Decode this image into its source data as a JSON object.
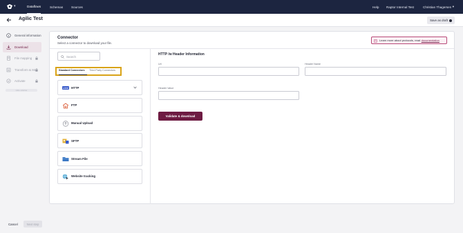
{
  "topbar": {
    "nav": [
      {
        "label": "Dataflows",
        "active": true
      },
      {
        "label": "Schemas",
        "active": false
      },
      {
        "label": "Sources",
        "active": false
      }
    ],
    "help": "Help",
    "workspace": "Raptor Internal Test",
    "user": "Christian Thagersen"
  },
  "header": {
    "title": "Agilic Test",
    "save_draft": "Save as draft"
  },
  "sidebar": {
    "items": [
      {
        "label": "General information",
        "icon": "info-icon",
        "active": false,
        "locked": false
      },
      {
        "label": "Download",
        "icon": "download-icon",
        "active": true,
        "locked": false
      },
      {
        "label": "File mapping",
        "icon": "file-icon",
        "active": false,
        "locked": true
      },
      {
        "label": "Transform & Map",
        "icon": "transform-icon",
        "active": false,
        "locked": true
      },
      {
        "label": "Activate",
        "icon": "activate-icon",
        "active": false,
        "locked": true
      }
    ],
    "pill": "Hide sidebar"
  },
  "connector": {
    "title": "Connector",
    "subtitle": "Select a connector to download your file.",
    "info_text": "Learn more about protocols, read",
    "info_link": "documentation",
    "search_placeholder": "Search",
    "tabs": [
      "Standard Connectors",
      "Third Party Connectors"
    ],
    "items": [
      {
        "label": "HTTP",
        "icon": "http-icon",
        "expandable": true
      },
      {
        "label": "FTP",
        "icon": "ftp-icon",
        "expandable": false
      },
      {
        "label": "Manual Upload",
        "icon": "upload-icon",
        "expandable": false
      },
      {
        "label": "SFTP",
        "icon": "sftp-icon",
        "expandable": false
      },
      {
        "label": "Stream File",
        "icon": "stream-file-icon",
        "expandable": false
      },
      {
        "label": "Website tracking",
        "icon": "website-tracking-icon",
        "expandable": false
      }
    ]
  },
  "form": {
    "title": "HTTP /w Header Information",
    "url_label": "Url",
    "url_value": "",
    "header_name_label": "Header Name",
    "header_name_value": "",
    "header_value_label": "Header Value",
    "header_value_value": "",
    "submit": "Validate & download"
  },
  "footer": {
    "cancel": "Cancel",
    "next": "Next step"
  },
  "colors": {
    "topbar": "#1c2540",
    "accent": "#6e1b42",
    "highlight": "#d9a317"
  }
}
